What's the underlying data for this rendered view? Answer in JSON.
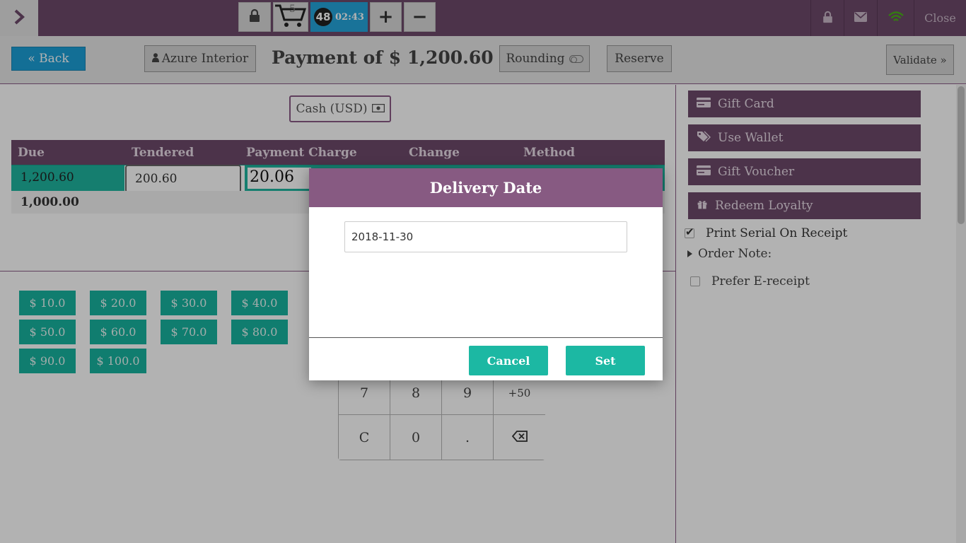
{
  "topbar": {
    "cart_count": "5",
    "order_count": "48",
    "timer": "02:43",
    "plus": "+",
    "minus": "−",
    "close_label": "Close"
  },
  "control": {
    "back_label": "« Back",
    "customer_label": "Azure Interior",
    "payment_title": "Payment of $ 1,200.60",
    "rounding_label": "Rounding",
    "reserve_label": "Reserve",
    "validate_label": "Validate »"
  },
  "payment": {
    "method_button": "Cash (USD)",
    "headers": [
      "Due",
      "Tendered",
      "Payment Charge",
      "Change",
      "Method"
    ],
    "due": "1,200.60",
    "tendered": "200.60",
    "charge": "20.06",
    "remaining": "1,000.00"
  },
  "quick_amounts": [
    "$ 10.0",
    "$ 20.0",
    "$ 30.0",
    "$ 40.0",
    "$ 50.0",
    "$ 60.0",
    "$ 70.0",
    "$ 80.0",
    "$ 90.0",
    "$ 100.0"
  ],
  "numpad": {
    "k7": "7",
    "k8": "8",
    "k9": "9",
    "kplus50": "+50",
    "kc": "C",
    "k0": "0",
    "kdot": "."
  },
  "right_panel": {
    "gift_card": "Gift Card",
    "use_wallet": "Use Wallet",
    "gift_voucher": "Gift Voucher",
    "redeem_loyalty": "Redeem Loyalty",
    "print_serial": "Print Serial On Receipt",
    "order_note": "Order Note:",
    "prefer_ereceipt": "Prefer E-receipt"
  },
  "modal": {
    "title": "Delivery Date",
    "date_value": "2018-11-30",
    "cancel_label": "Cancel",
    "set_label": "Set"
  },
  "colors": {
    "primary_purple": "#6e4a6b",
    "modal_header": "#875a82",
    "teal": "#1cb8a3",
    "blue": "#1c9fd7"
  }
}
